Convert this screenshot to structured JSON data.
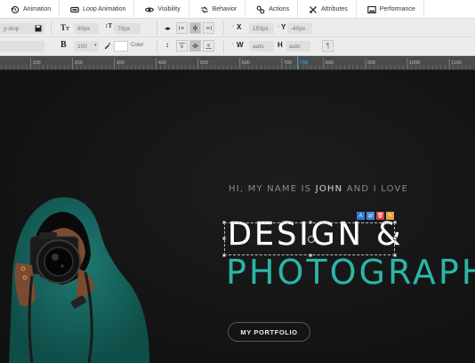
{
  "tabs": [
    {
      "label": "Animation",
      "icon": "history-icon"
    },
    {
      "label": "Loop Animation",
      "icon": "loop-icon"
    },
    {
      "label": "Visibility",
      "icon": "eye-icon"
    },
    {
      "label": "Behavior",
      "icon": "shuffle-icon"
    },
    {
      "label": "Actions",
      "icon": "link-icon"
    },
    {
      "label": "Attributes",
      "icon": "tools-icon"
    },
    {
      "label": "Performance",
      "icon": "image-icon"
    }
  ],
  "props": {
    "class_value": "y-disp",
    "font_size": "80px",
    "line_height": "70px",
    "font_weight": "100",
    "color_label": "Color",
    "x_label": "X",
    "x_value": "153px",
    "y_label": "Y",
    "y_value": "-40px",
    "w_label": "W",
    "w_value": "auto",
    "h_label": "H",
    "h_value": "auto",
    "accent": "#2bb5a9"
  },
  "ruler": {
    "ticks": [
      "100",
      "200",
      "300",
      "400",
      "500",
      "600",
      "700",
      "738",
      "800",
      "900",
      "1000",
      "1100"
    ],
    "marker": "738"
  },
  "canvas": {
    "intro_before": "HI, MY NAME IS",
    "intro_name": "JOHN",
    "intro_after": "AND I LOVE",
    "heading_1": "DESIGN &",
    "heading_2": "PHOTOGRAPHY",
    "cta": "MY PORTFOLIO"
  }
}
